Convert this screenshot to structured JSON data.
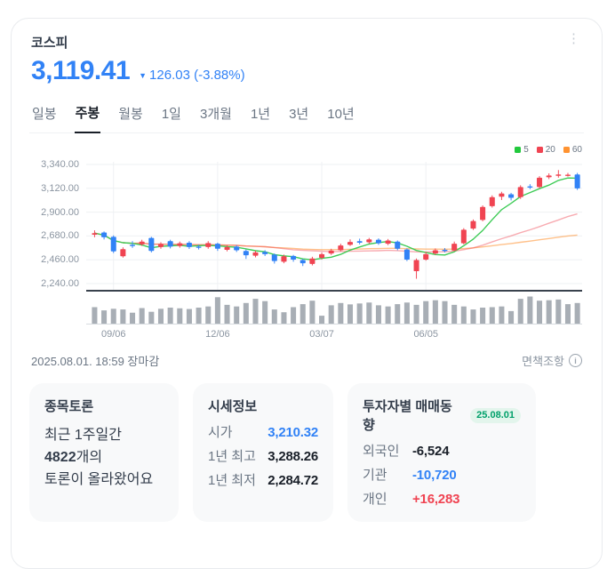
{
  "header": {
    "title": "코스피"
  },
  "price": {
    "value": "3,119.41",
    "change_arrow": "▼",
    "change_text": "126.03 (-3.88%)",
    "accent_color": "#3182f6"
  },
  "tabs": {
    "active_index": 1,
    "items": [
      {
        "label": "일봉"
      },
      {
        "label": "주봉"
      },
      {
        "label": "월봉"
      },
      {
        "label": "1일"
      },
      {
        "label": "3개월"
      },
      {
        "label": "1년"
      },
      {
        "label": "3년"
      },
      {
        "label": "10년"
      }
    ]
  },
  "chart_data": {
    "type": "candlestick",
    "title": "코스피 주봉 차트",
    "y_ticks": [
      "3,340.00",
      "3,120.00",
      "2,900.00",
      "2,680.00",
      "2,460.00",
      "2,240.00"
    ],
    "y_min": 2240,
    "y_max": 3340,
    "x_labels": [
      {
        "label": "09/06",
        "index": 2
      },
      {
        "label": "12/06",
        "index": 13
      },
      {
        "label": "03/07",
        "index": 24
      },
      {
        "label": "06/05",
        "index": 35
      }
    ],
    "legend": [
      {
        "label": "5",
        "color": "#22c93d"
      },
      {
        "label": "20",
        "color": "#f04452"
      },
      {
        "label": "60",
        "color": "#ff9331"
      }
    ],
    "colors": {
      "up": "#f04452",
      "down": "#3182f6",
      "ma5": "#3ecb56",
      "ma20": "rgba(240,68,82,0.45)",
      "ma60": "rgba(255,151,60,0.6)",
      "volume": "#a8aeb5",
      "grid": "#eef0f3"
    },
    "candles_ochl": [
      [
        2692,
        2706,
        2732,
        2668
      ],
      [
        2712,
        2668,
        2722,
        2648
      ],
      [
        2672,
        2538,
        2685,
        2522
      ],
      [
        2492,
        2558,
        2575,
        2480
      ],
      [
        2598,
        2588,
        2632,
        2570
      ],
      [
        2602,
        2628,
        2645,
        2588
      ],
      [
        2662,
        2542,
        2672,
        2528
      ],
      [
        2578,
        2605,
        2622,
        2562
      ],
      [
        2632,
        2582,
        2645,
        2565
      ],
      [
        2588,
        2612,
        2628,
        2572
      ],
      [
        2618,
        2578,
        2632,
        2560
      ],
      [
        2582,
        2575,
        2598,
        2555
      ],
      [
        2578,
        2615,
        2632,
        2562
      ],
      [
        2608,
        2562,
        2618,
        2542
      ],
      [
        2552,
        2578,
        2592,
        2538
      ],
      [
        2582,
        2548,
        2595,
        2532
      ],
      [
        2542,
        2502,
        2555,
        2468
      ],
      [
        2498,
        2528,
        2545,
        2482
      ],
      [
        2532,
        2512,
        2548,
        2495
      ],
      [
        2508,
        2448,
        2518,
        2425
      ],
      [
        2442,
        2492,
        2508,
        2428
      ],
      [
        2495,
        2462,
        2505,
        2442
      ],
      [
        2458,
        2428,
        2468,
        2402
      ],
      [
        2422,
        2472,
        2488,
        2408
      ],
      [
        2478,
        2512,
        2528,
        2462
      ],
      [
        2518,
        2545,
        2562,
        2505
      ],
      [
        2548,
        2592,
        2608,
        2538
      ],
      [
        2598,
        2625,
        2648,
        2588
      ],
      [
        2632,
        2618,
        2655,
        2602
      ],
      [
        2622,
        2648,
        2662,
        2608
      ],
      [
        2645,
        2612,
        2658,
        2598
      ],
      [
        2608,
        2638,
        2652,
        2595
      ],
      [
        2628,
        2562,
        2638,
        2548
      ],
      [
        2555,
        2462,
        2565,
        2448
      ],
      [
        2355,
        2458,
        2472,
        2284.72
      ],
      [
        2462,
        2512,
        2532,
        2452
      ],
      [
        2518,
        2548,
        2565,
        2505
      ],
      [
        2552,
        2542,
        2568,
        2528
      ],
      [
        2545,
        2608,
        2628,
        2538
      ],
      [
        2612,
        2738,
        2752,
        2602
      ],
      [
        2748,
        2818,
        2832,
        2735
      ],
      [
        2828,
        2948,
        2962,
        2815
      ],
      [
        2955,
        3038,
        3055,
        2942
      ],
      [
        3042,
        3072,
        3088,
        3012
      ],
      [
        3065,
        3032,
        3078,
        3008
      ],
      [
        3038,
        3132,
        3148,
        3022
      ],
      [
        3138,
        3128,
        3158,
        3112
      ],
      [
        3132,
        3218,
        3232,
        3120
      ],
      [
        3222,
        3238,
        3258,
        3205
      ],
      [
        3235,
        3248,
        3288.26,
        3218
      ],
      [
        3242,
        3245.44,
        3262,
        3228
      ],
      [
        3248,
        3119.41,
        3262,
        3105
      ]
    ],
    "volume_rel": [
      0.52,
      0.38,
      0.45,
      0.42,
      0.28,
      0.48,
      0.32,
      0.45,
      0.5,
      0.47,
      0.44,
      0.5,
      0.55,
      0.95,
      0.62,
      0.55,
      0.7,
      0.88,
      0.78,
      0.42,
      0.3,
      0.52,
      0.65,
      0.8,
      0.15,
      0.6,
      0.7,
      0.64,
      0.68,
      0.72,
      0.6,
      0.55,
      0.65,
      0.72,
      0.62,
      0.78,
      0.82,
      0.78,
      0.62,
      0.55,
      0.42,
      0.5,
      0.52,
      0.55,
      0.35,
      0.88,
      0.98,
      0.8,
      0.82,
      0.85,
      0.65,
      0.7
    ]
  },
  "footer": {
    "timestamp": "2025.08.01. 18:59 장마감",
    "disclaimer": "면책조항"
  },
  "cards": {
    "discussion": {
      "title": "종목토론",
      "line1": "최근 1주일간",
      "count": "4822",
      "count_suffix": "개의",
      "line2": "토론이 올라왔어요"
    },
    "quote": {
      "title": "시세정보",
      "rows": [
        {
          "label": "시가",
          "value": "3,210.32",
          "color": "#3182f6"
        },
        {
          "label": "1년 최고",
          "value": "3,288.26",
          "color": "#191f28"
        },
        {
          "label": "1년 최저",
          "value": "2,284.72",
          "color": "#191f28"
        }
      ]
    },
    "investors": {
      "title": "투자자별 매매동향",
      "badge": "25.08.01",
      "rows": [
        {
          "label": "외국인",
          "value": "-6,524",
          "color": "#191f28"
        },
        {
          "label": "기관",
          "value": "-10,720",
          "color": "#3182f6"
        },
        {
          "label": "개인",
          "value": "+16,283",
          "color": "#f04452"
        }
      ]
    }
  }
}
